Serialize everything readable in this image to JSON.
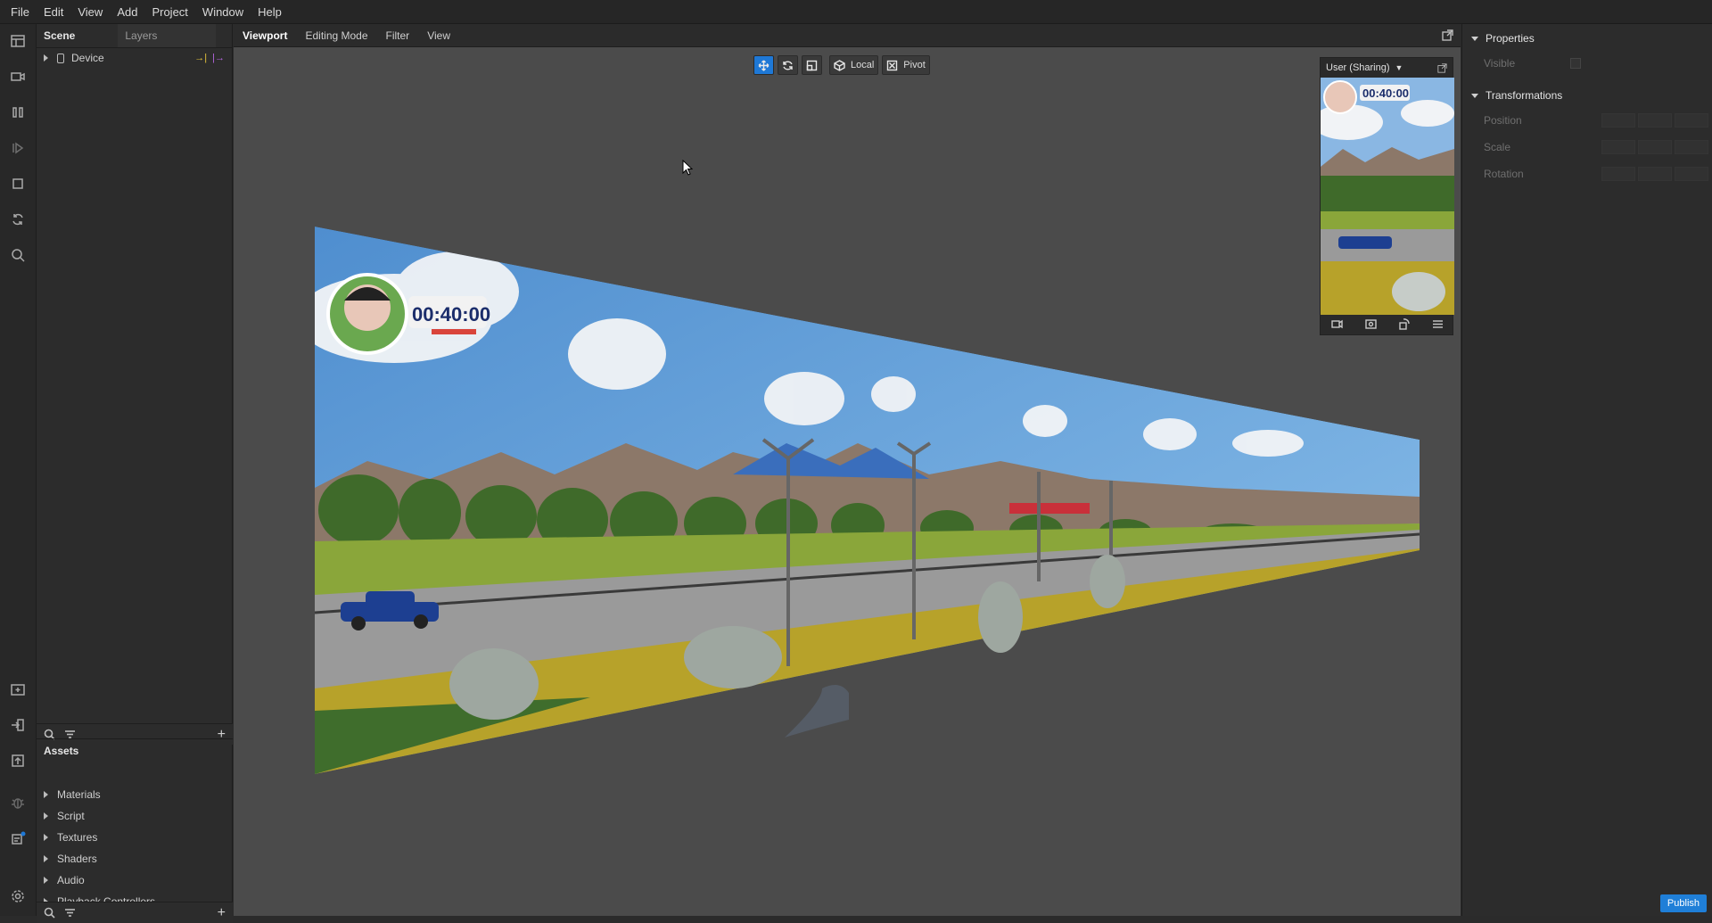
{
  "menu": [
    "File",
    "Edit",
    "View",
    "Add",
    "Project",
    "Window",
    "Help"
  ],
  "rail": {
    "top": [
      "layout-icon",
      "camera-icon",
      "pause-icon",
      "step-icon",
      "stop-icon",
      "refresh-icon",
      "search-icon"
    ],
    "bottom": [
      "import-icon",
      "login-icon",
      "upload-icon",
      "bug-icon",
      "notification-icon",
      "settings-icon"
    ]
  },
  "scene": {
    "tab_scene": "Scene",
    "tab_layers": "Layers",
    "items": [
      {
        "label": "Device"
      }
    ]
  },
  "assets": {
    "title": "Assets",
    "items": [
      "Materials",
      "Script",
      "Textures",
      "Shaders",
      "Audio",
      "Playback Controllers"
    ]
  },
  "viewport": {
    "tabs": [
      "Viewport",
      "Editing Mode",
      "Filter",
      "View"
    ],
    "gizmo": {
      "local_label": "Local",
      "pivot_label": "Pivot"
    },
    "preview": {
      "label": "User (Sharing)",
      "timer": "00:40:00"
    },
    "scene_timer": "00:40:00"
  },
  "properties": {
    "title": "Properties",
    "visible_label": "Visible",
    "transformations_title": "Transformations",
    "position_label": "Position",
    "scale_label": "Scale",
    "rotation_label": "Rotation"
  },
  "publish_label": "Publish",
  "colors": {
    "accent": "#1e78d6",
    "viewport_bg": "#4b4b4b"
  }
}
